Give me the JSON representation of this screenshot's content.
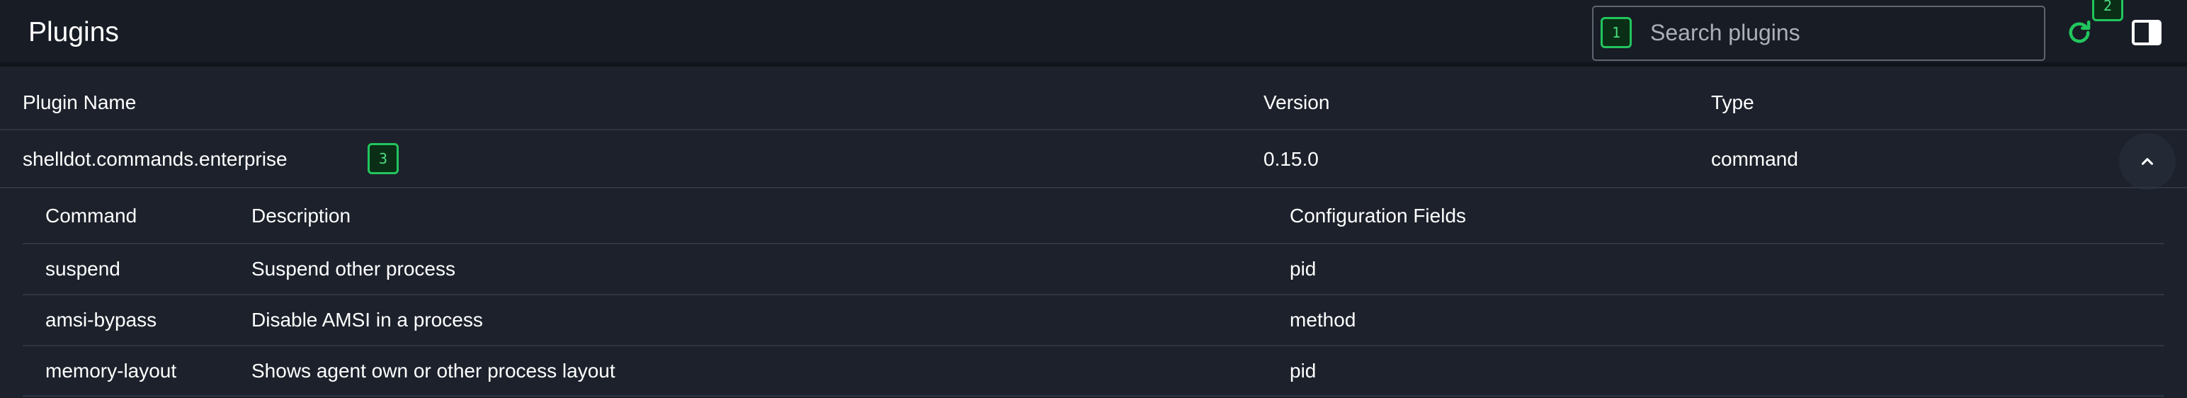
{
  "header": {
    "title": "Plugins",
    "search": {
      "placeholder": "Search plugins",
      "value": ""
    },
    "badges": [
      "1",
      "2"
    ],
    "icons": {
      "search": "search-icon",
      "refresh": "refresh-icon",
      "panel": "side-panel-icon"
    }
  },
  "table": {
    "columns": [
      "Plugin Name",
      "Version",
      "Type"
    ],
    "rows": [
      {
        "name": "shelldot.commands.enterprise",
        "version": "0.15.0",
        "type": "command",
        "badge": "3"
      }
    ]
  },
  "subtable": {
    "columns": [
      "Command",
      "Description",
      "Configuration Fields"
    ],
    "rows": [
      {
        "command": "suspend",
        "description": "Suspend other process",
        "fields": "pid"
      },
      {
        "command": "amsi-bypass",
        "description": "Disable AMSI in a process",
        "fields": "method"
      },
      {
        "command": "memory-layout",
        "description": "Shows agent own or other process layout",
        "fields": "pid"
      }
    ]
  },
  "colors": {
    "accent": "#22c55e",
    "background": "#1c212b",
    "header": "#181c25",
    "divider": "#2f3542"
  }
}
